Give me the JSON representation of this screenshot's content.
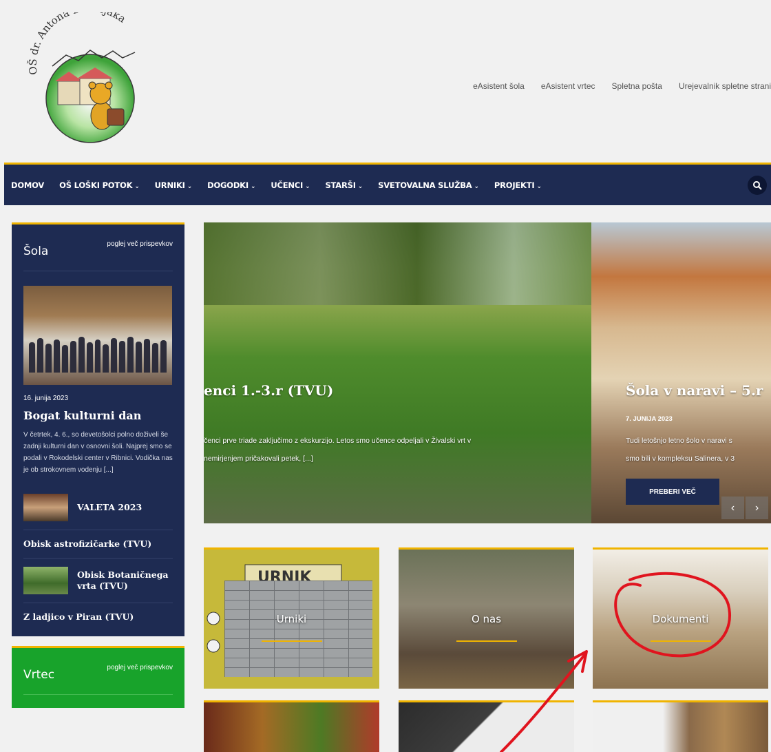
{
  "header": {
    "logo_text": "OŠ dr. Antona Debeljaka",
    "links": [
      "eAsistent šola",
      "eAsistent vrtec",
      "Spletna pošta",
      "Urejevalnik spletne strani"
    ]
  },
  "nav": {
    "items": [
      {
        "label": "DOMOV",
        "dropdown": false
      },
      {
        "label": "OŠ LOŠKI POTOK",
        "dropdown": true
      },
      {
        "label": "URNIKI",
        "dropdown": true
      },
      {
        "label": "DOGODKI",
        "dropdown": true
      },
      {
        "label": "UČENCI",
        "dropdown": true
      },
      {
        "label": "STARŠI",
        "dropdown": true
      },
      {
        "label": "SVETOVALNA SLUŽBA",
        "dropdown": true
      },
      {
        "label": "PROJEKTI",
        "dropdown": true
      }
    ],
    "chevron": "⌄"
  },
  "sidebar": {
    "sola": {
      "title": "Šola",
      "more": "poglej več prispevkov",
      "featured": {
        "date": "16. junija 2023",
        "title": "Bogat kulturni dan",
        "excerpt": "V četrtek, 4. 6., so devetošolci polno doživeli še zadnji kulturni dan v osnovni šoli. Najprej smo se podali v Rokodelski center v Ribnici. Vodička nas je ob strokovnem vodenju [...]"
      },
      "items": [
        {
          "title": "VALETA 2023",
          "thumb": true
        },
        {
          "title": "Obisk astrofizičarke (TVU)",
          "thumb": false
        },
        {
          "title": "Obisk Botaničnega vrta (TVU)",
          "thumb": true
        },
        {
          "title": "Z ladjico v Piran (TVU)",
          "thumb": false
        }
      ]
    },
    "vrtec": {
      "title": "Vrtec",
      "more": "poglej več prispevkov"
    }
  },
  "slider": {
    "slide1": {
      "title": "enci 1.-3.r (TVU)",
      "text_line1": "čenci prve triade zaključimo z ekskurzijo. Letos smo učence odpeljali v Živalski vrt v",
      "text_line2": "nemirjenjem pričakovali petek, [...]"
    },
    "slide2": {
      "title": "Šola v naravi – 5.r",
      "date": "7. JUNIJA 2023",
      "text_line1": "Tudi letošnjo letno šolo v naravi s",
      "text_line2": "smo bili v kompleksu Salinera, v 3",
      "button": "PREBERI VEČ"
    },
    "prev": "‹",
    "next": "›"
  },
  "tiles": {
    "urniki": {
      "label": "Urniki",
      "sign": "URNIK"
    },
    "onas": {
      "label": "O nas"
    },
    "dokumenti": {
      "label": "Dokumenti"
    }
  },
  "colors": {
    "navy": "#1e2b52",
    "gold": "#f0b400",
    "green": "#18a32b",
    "annotation_red": "#e0141e"
  }
}
